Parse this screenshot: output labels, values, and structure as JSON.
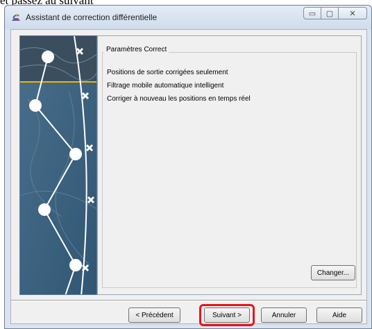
{
  "caption_text": "et passez au suivant",
  "window": {
    "title": "Assistant de correction différentielle",
    "minimize_glyph": "▭",
    "maximize_glyph": "▢",
    "close_glyph": "✕"
  },
  "group": {
    "legend": "Paramètres Correct",
    "options": [
      "Positions de sortie corrigées seulement",
      "Filtrage mobile automatique intelligent",
      "Corriger à nouveau les positions en temps réel"
    ],
    "change_button": "Changer..."
  },
  "buttons": {
    "previous": "< Précédent",
    "next": "Suivant >",
    "cancel": "Annuler",
    "help": "Aide"
  },
  "colors": {
    "highlight": "#e8141c",
    "accent_line": "#f2b500"
  },
  "icons": {
    "app_icon": "satellite-dish-icon"
  }
}
